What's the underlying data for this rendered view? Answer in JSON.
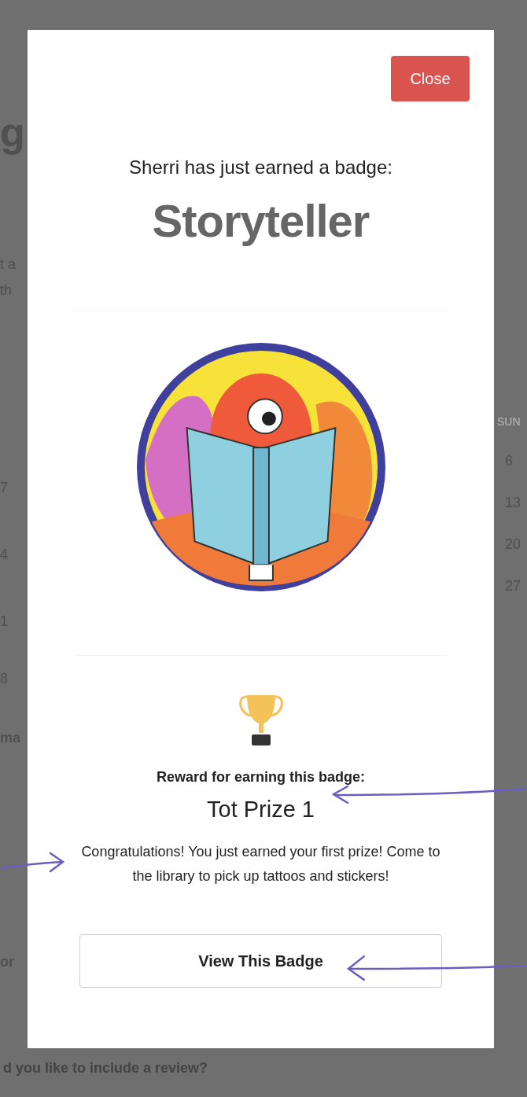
{
  "background": {
    "left_fragments": [
      "g",
      "t a",
      "th",
      "7",
      "4",
      "1",
      "8",
      "ma",
      "or"
    ],
    "right_fragments": [
      "SUN",
      "6",
      "13",
      "20",
      "27"
    ],
    "bottom_text": "d you like to include a review?"
  },
  "modal": {
    "close_button": "Close",
    "heading": "Sherri has just earned a badge:",
    "badge_name": "Storyteller",
    "reward_label": "Reward for earning this badge:",
    "reward_name": "Tot Prize 1",
    "reward_message": "Congratulations! You just earned your first prize! Come to the library to pick up tattoos and stickers!",
    "view_button": "View This Badge"
  }
}
